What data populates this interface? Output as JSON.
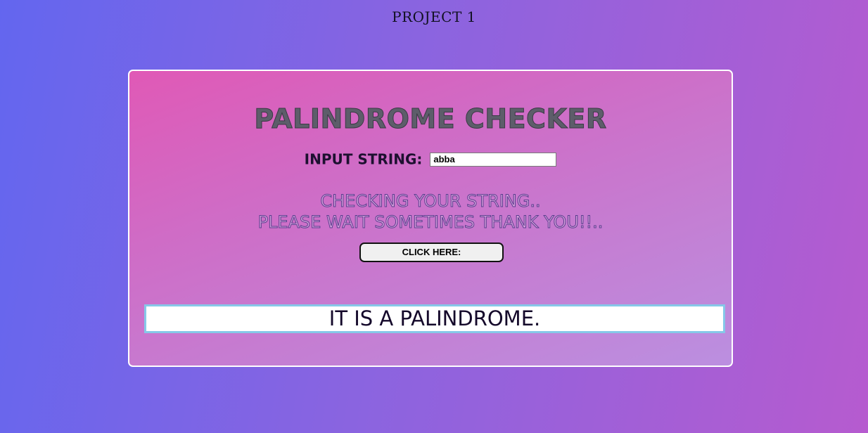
{
  "header": {
    "project_title": "PROJECT 1"
  },
  "checker": {
    "title": "PALINDROME CHECKER",
    "input_label": "INPUT STRING:",
    "input_value": "abba",
    "wait_line1": "CHECKING YOUR STRING..",
    "wait_line2": "PLEASE WAIT SOMETIMES THANK YOU!!..",
    "button_label": "CLICK HERE:",
    "result": "IT IS A PALINDROME."
  },
  "colors": {
    "background_start": "#6366ef",
    "background_end": "#b65bcf",
    "card_start": "#e059b6",
    "card_end": "#bb8fe0",
    "result_border": "#86c8e8"
  }
}
